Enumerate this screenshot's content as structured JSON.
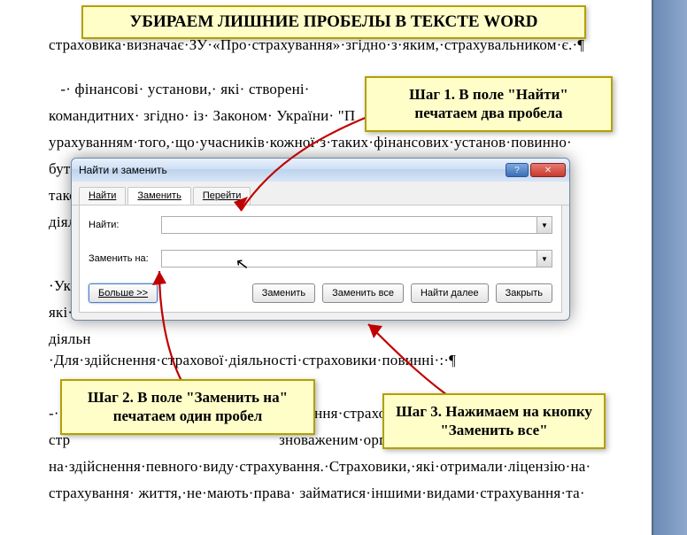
{
  "banner": "УБИРАЕМ ЛИШНИЕ ПРОБЕЛЫ В ТЕКСТЕ WORD",
  "bg_text": {
    "line0": "страховика·визначає·ЗУ·«Про·страхування»·згідно·з·яким,·страхувальником·є.·¶",
    "p1": "   -· фінансові· установи,· які· створені·\nкомандитних· згідно· із· Законом· України· \"П\nурахуванням·того,·що·учасників·кожної·з·таких·фінансових·установ·повинно·\nбути·\nтакож·\nдіяльн",
    "p2": "·Україн\nякі· од\nдіяльн",
    "p3": "·Для·здійснення·страхової·діяльності·страховики·повинні·:·¶\n\n-·                                                               яння·страховою·\nстр                                                     зноваженим·органом·\nна·здійснення·певного·виду·страхування.·Страховики,·які·отримали·ліцензію·на·\nстрахування· життя,·не·мають·права· займатися·іншими·видами·страхування·та·"
  },
  "dialog": {
    "title": "Найти и заменить",
    "tabs": {
      "find": "Найти",
      "replace": "Заменить",
      "goto": "Перейти"
    },
    "find_label": "Найти:",
    "replace_label": "Заменить на:",
    "find_value": "",
    "replace_value": "",
    "more": "Больше >>",
    "btn_replace": "Заменить",
    "btn_replace_all": "Заменить все",
    "btn_find_next": "Найти далее",
    "btn_close": "Закрыть",
    "help_sym": "?",
    "close_sym": "✕"
  },
  "callouts": {
    "step1": "Шаг 1. В поле \"Найти\" печатаем два пробела",
    "step2": "Шаг 2. В поле \"Заменить на\" печатаем один пробел",
    "step3": "Шаг 3. Нажимаем на кнопку \"Заменить все\""
  }
}
